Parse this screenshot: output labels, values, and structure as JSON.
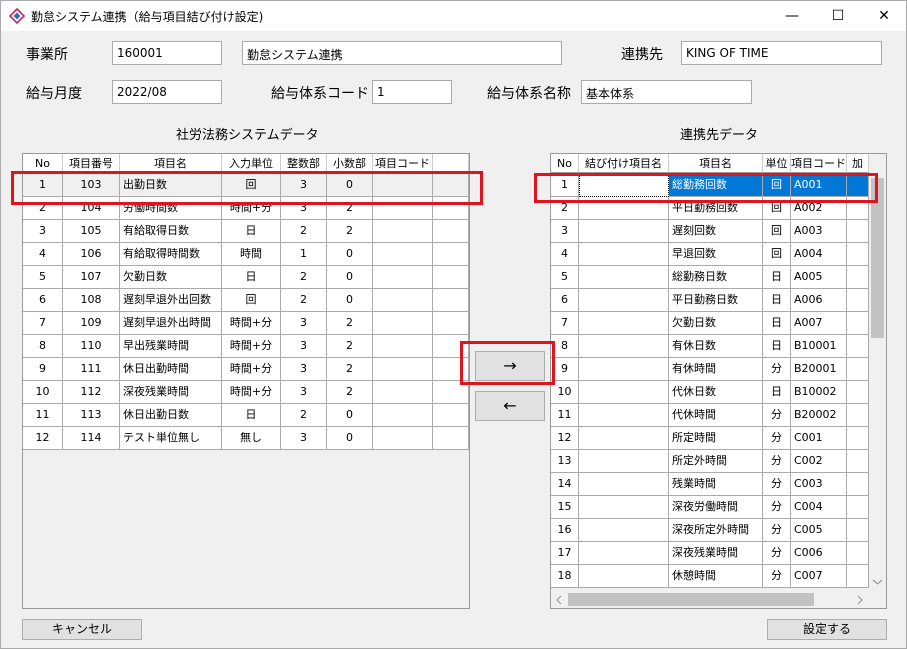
{
  "window": {
    "title": "勤怠システム連携（給与項目結び付け設定)",
    "minimize": "—",
    "maximize": "☐",
    "close": "✕"
  },
  "form": {
    "office_label": "事業所",
    "office_code": "160001",
    "office_name": "勤怠システム連携",
    "partner_label": "連携先",
    "partner_value": "KING OF TIME",
    "month_label": "給与月度",
    "month_value": "2022/08",
    "system_code_label": "給与体系コード",
    "system_code_value": "1",
    "system_name_label": "給与体系名称",
    "system_name_value": "基本体系"
  },
  "left_grid": {
    "title": "社労法務システムデータ",
    "headers": [
      "No",
      "項目番号",
      "項目名",
      "入力単位",
      "整数部",
      "小数部",
      "項目コード"
    ],
    "rows": [
      [
        "1",
        "103",
        "出勤日数",
        "回",
        "3",
        "0",
        ""
      ],
      [
        "2",
        "104",
        "労働時間数",
        "時間+分",
        "3",
        "2",
        ""
      ],
      [
        "3",
        "105",
        "有給取得日数",
        "日",
        "2",
        "2",
        ""
      ],
      [
        "4",
        "106",
        "有給取得時間数",
        "時間",
        "1",
        "0",
        ""
      ],
      [
        "5",
        "107",
        "欠勤日数",
        "日",
        "2",
        "0",
        ""
      ],
      [
        "6",
        "108",
        "遅刻早退外出回数",
        "回",
        "2",
        "0",
        ""
      ],
      [
        "7",
        "109",
        "遅刻早退外出時間",
        "時間+分",
        "3",
        "2",
        ""
      ],
      [
        "8",
        "110",
        "早出残業時間",
        "時間+分",
        "3",
        "2",
        ""
      ],
      [
        "9",
        "111",
        "休日出勤時間",
        "時間+分",
        "3",
        "2",
        ""
      ],
      [
        "10",
        "112",
        "深夜残業時間",
        "時間+分",
        "3",
        "2",
        ""
      ],
      [
        "11",
        "113",
        "休日出勤日数",
        "日",
        "2",
        "0",
        ""
      ],
      [
        "12",
        "114",
        "テスト単位無し",
        "無し",
        "3",
        "0",
        ""
      ]
    ]
  },
  "right_grid": {
    "title": "連携先データ",
    "headers": [
      "No",
      "結び付け項目名",
      "項目名",
      "単位",
      "項目コード",
      "加"
    ],
    "rows": [
      [
        "1",
        "",
        "総勤務回数",
        "回",
        "A001"
      ],
      [
        "2",
        "",
        "平日勤務回数",
        "回",
        "A002"
      ],
      [
        "3",
        "",
        "遅刻回数",
        "回",
        "A003"
      ],
      [
        "4",
        "",
        "早退回数",
        "回",
        "A004"
      ],
      [
        "5",
        "",
        "総勤務日数",
        "日",
        "A005"
      ],
      [
        "6",
        "",
        "平日勤務日数",
        "日",
        "A006"
      ],
      [
        "7",
        "",
        "欠勤日数",
        "日",
        "A007"
      ],
      [
        "8",
        "",
        "有休日数",
        "日",
        "B10001"
      ],
      [
        "9",
        "",
        "有休時間",
        "分",
        "B20001"
      ],
      [
        "10",
        "",
        "代休日数",
        "日",
        "B10002"
      ],
      [
        "11",
        "",
        "代休時間",
        "分",
        "B20002"
      ],
      [
        "12",
        "",
        "所定時間",
        "分",
        "C001"
      ],
      [
        "13",
        "",
        "所定外時間",
        "分",
        "C002"
      ],
      [
        "14",
        "",
        "残業時間",
        "分",
        "C003"
      ],
      [
        "15",
        "",
        "深夜労働時間",
        "分",
        "C004"
      ],
      [
        "16",
        "",
        "深夜所定外時間",
        "分",
        "C005"
      ],
      [
        "17",
        "",
        "深夜残業時間",
        "分",
        "C006"
      ],
      [
        "18",
        "",
        "休憩時間",
        "分",
        "C007"
      ]
    ]
  },
  "buttons": {
    "link": "→",
    "unlink": "←",
    "cancel": "キャンセル",
    "apply": "設定する"
  },
  "colors": {
    "selection": "#0078d7",
    "highlight": "#e0141e"
  }
}
